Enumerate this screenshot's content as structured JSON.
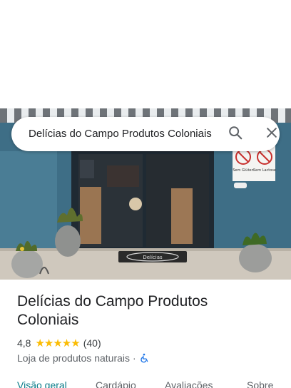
{
  "search": {
    "query": "Delícias do Campo Produtos Coloniais"
  },
  "place": {
    "name": "Delícias do Campo Produtos Coloniais",
    "rating": "4,8",
    "stars": "★★★★★",
    "reviews": "(40)",
    "category": "Loja de produtos naturais",
    "separator": "·"
  },
  "photo_signs": {
    "sem_gluten": "Sem Glúten",
    "sem_lactose": "Sem Lactose",
    "doormat": "Delícias"
  },
  "tabs": [
    "Visão geral",
    "Cardápio",
    "Avaliações",
    "Sobre"
  ],
  "colors": {
    "accent": "#0b7d8a",
    "stars": "#fbbc04",
    "wall": "#3f6f88"
  }
}
